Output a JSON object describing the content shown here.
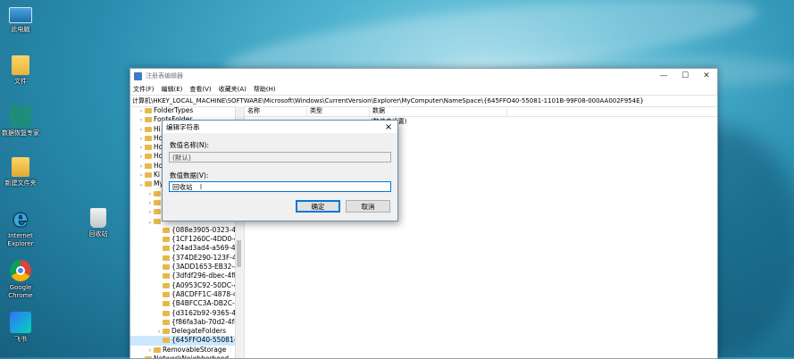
{
  "desktop": {
    "icons": [
      {
        "label": "此电脑"
      },
      {
        "label": "文件"
      },
      {
        "label": "数据恢复专家"
      },
      {
        "label": "新建文件夹"
      },
      {
        "label": "Internet Explorer"
      },
      {
        "label": "回收站"
      },
      {
        "label": "Google Chrome"
      },
      {
        "label": "飞书"
      }
    ]
  },
  "window": {
    "title": "注册表编辑器",
    "menu": [
      "文件(F)",
      "编辑(E)",
      "查看(V)",
      "收藏夹(A)",
      "帮助(H)"
    ],
    "address": "计算机\\HKEY_LOCAL_MACHINE\\SOFTWARE\\Microsoft\\Windows\\CurrentVersion\\Explorer\\MyComputer\\NameSpace\\{645FFO40-55081-1101B-99F08-000AA002F954E}",
    "tree": [
      {
        "label": "FolderTypes",
        "level": 1,
        "expanded": false
      },
      {
        "label": "FontsFolder",
        "level": 1,
        "expanded": false
      },
      {
        "label": "Hi",
        "level": 1,
        "expanded": false
      },
      {
        "label": "Ho",
        "level": 1,
        "expanded": false
      },
      {
        "label": "Ho",
        "level": 1,
        "expanded": false
      },
      {
        "label": "Ho",
        "level": 1,
        "expanded": false
      },
      {
        "label": "Ho",
        "level": 1,
        "expanded": false
      },
      {
        "label": "Ki",
        "level": 1,
        "expanded": false
      },
      {
        "label": "My",
        "level": 1,
        "expanded": true
      },
      {
        "label": "",
        "level": 2,
        "expanded": false
      },
      {
        "label": "",
        "level": 2,
        "expanded": false
      },
      {
        "label": "",
        "level": 2,
        "expanded": false
      },
      {
        "label": "",
        "level": 2,
        "expanded": true
      },
      {
        "label": "{088e3905-0323-4b",
        "level": 3,
        "expanded": false
      },
      {
        "label": "{1CF1260C-4DD0-4",
        "level": 3,
        "expanded": false
      },
      {
        "label": "{24ad3ad4-a569-45",
        "level": 3,
        "expanded": false
      },
      {
        "label": "{374DE290-123F-45",
        "level": 3,
        "expanded": false
      },
      {
        "label": "{3ADD1653-EB32-4c",
        "level": 3,
        "expanded": false
      },
      {
        "label": "{3dfdf296-dbec-4fb",
        "level": 3,
        "expanded": false
      },
      {
        "label": "{A0953C92-50DC-43",
        "level": 3,
        "expanded": false
      },
      {
        "label": "{A8CDFF1C-4878-43",
        "level": 3,
        "expanded": false
      },
      {
        "label": "{B4BFCC3A-DB2C-42",
        "level": 3,
        "expanded": false
      },
      {
        "label": "{d3162b92-9365-46",
        "level": 3,
        "expanded": false
      },
      {
        "label": "{f86fa3ab-70d2-4fc7",
        "level": 3,
        "expanded": false
      },
      {
        "label": "DelegateFolders",
        "level": 3,
        "expanded": false,
        "has_arrow": true
      },
      {
        "label": "{645FFO40-55081-1",
        "level": 3,
        "expanded": false,
        "selected": true
      },
      {
        "label": "RemovableStorage",
        "level": 2,
        "expanded": false,
        "has_arrow": true
      },
      {
        "label": "NetworkNeighborhood",
        "level": 1,
        "expanded": false,
        "has_arrow": true
      }
    ],
    "list_headers": [
      "名称",
      "类型",
      "数据"
    ],
    "list_rows": [
      {
        "name": "",
        "type": "",
        "data": "(数值未设置)"
      }
    ]
  },
  "dialog": {
    "title": "编辑字符串",
    "name_label": "数值名称(N):",
    "name_value": "(默认)",
    "data_label": "数值数据(V):",
    "data_value": "回收站",
    "ok_label": "确定",
    "cancel_label": "取消"
  },
  "colors": {
    "selection": "#cce8ff",
    "focus_border": "#0078d7"
  }
}
